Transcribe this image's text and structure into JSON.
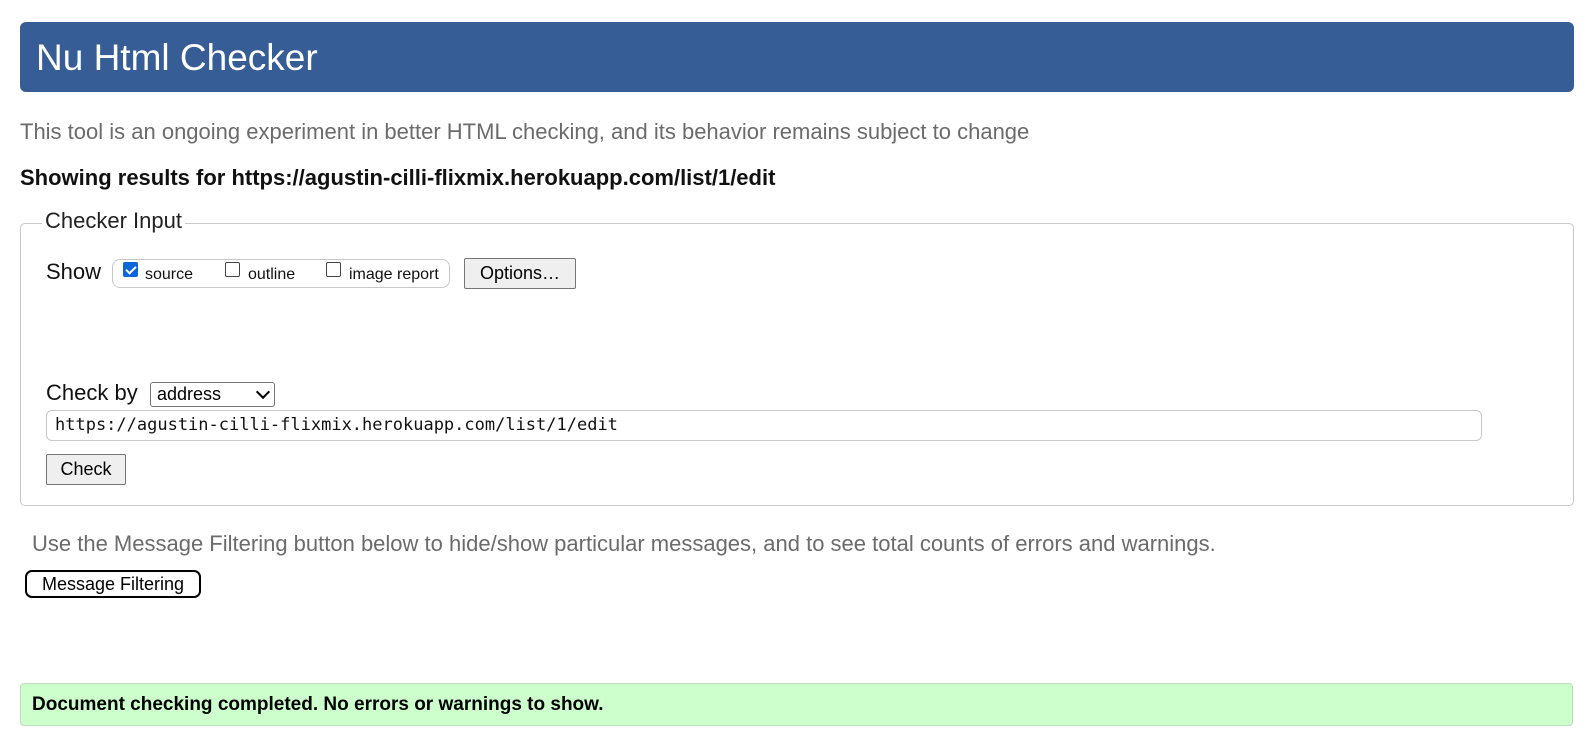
{
  "header": {
    "title": "Nu Html Checker"
  },
  "tagline": "This tool is an ongoing experiment in better HTML checking, and its behavior remains subject to change",
  "showing_results": "Showing results for https://agustin-cilli-flixmix.herokuapp.com/list/1/edit",
  "checker_input": {
    "legend": "Checker Input",
    "show_label": "Show",
    "checkboxes": [
      {
        "label": "source",
        "checked": true
      },
      {
        "label": "outline",
        "checked": false
      },
      {
        "label": "image report",
        "checked": false
      }
    ],
    "options_button": "Options…",
    "check_by_label": "Check by",
    "check_by_value": "address",
    "url_value": "https://agustin-cilli-flixmix.herokuapp.com/list/1/edit",
    "check_button": "Check"
  },
  "filter_note": "Use the Message Filtering button below to hide/show particular messages, and to see total counts of errors and warnings.",
  "filter_button": "Message Filtering",
  "result_message": "Document checking completed. No errors or warnings to show.",
  "colors": {
    "header_bg": "#365d95",
    "success_bg": "#ccffcc",
    "checkbox_accent": "#0b66d9"
  }
}
